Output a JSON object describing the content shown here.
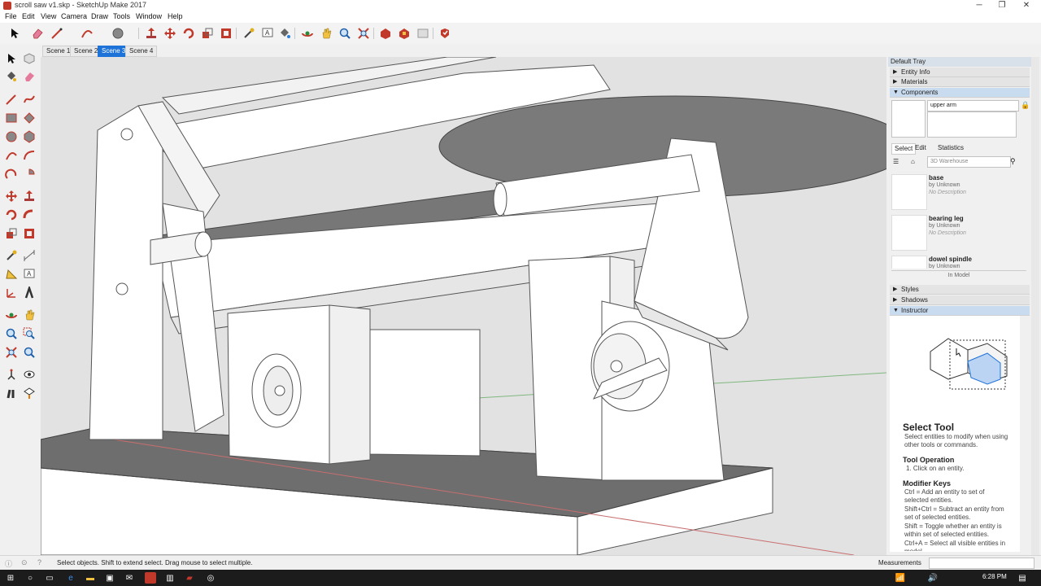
{
  "window": {
    "title": "scroll saw v1.skp - SketchUp Make 2017",
    "minimize": "─",
    "maximize": "❐",
    "close": "✕"
  },
  "menu": [
    "File",
    "Edit",
    "View",
    "Camera",
    "Draw",
    "Tools",
    "Window",
    "Help"
  ],
  "toolbar": {
    "icons": [
      "select-icon",
      "eraser-icon",
      "line-icon",
      "arc-icon",
      "shape-icon",
      "push-pull-icon",
      "move-icon",
      "rotate-icon",
      "scale-icon",
      "offset-icon",
      "tape-measure-icon",
      "text-icon",
      "paint-bucket-icon",
      "orbit-icon",
      "pan-icon",
      "zoom-icon",
      "zoom-extents-icon",
      "3d-warehouse-icon",
      "extension-warehouse-icon",
      "layout-icon",
      "extension-manager-icon",
      "ruby-icon"
    ]
  },
  "scenes": [
    "Scene 1",
    "Scene 2",
    "Scene 3",
    "Scene 4"
  ],
  "active_scene": "Scene 3",
  "tray": {
    "title": "Default Tray",
    "sections_top": [
      "Entity Info",
      "Materials",
      "Components"
    ],
    "component_name": "upper arm",
    "tabs": [
      "Select",
      "Edit",
      "Statistics"
    ],
    "search_placeholder": "3D Warehouse",
    "items": [
      {
        "name": "base",
        "by": "by Unknown",
        "desc": "No Description"
      },
      {
        "name": "bearing leg",
        "by": "by Unknown",
        "desc": "No Description"
      },
      {
        "name": "dowel spindle",
        "by": "by Unknown",
        "desc": ""
      }
    ],
    "in_model": "In Model",
    "sections_bottom": [
      "Styles",
      "Shadows",
      "Instructor"
    ],
    "instructor": {
      "title": "Select Tool",
      "intro": "Select entities to modify when using other tools or commands.",
      "op_title": "Tool Operation",
      "op_step": "1. Click on an entity.",
      "mod_title": "Modifier Keys",
      "mod_lines": [
        "Ctrl = Add an entity to set of selected entities.",
        "Shift+Ctrl = Subtract an entity from set of selected entities.",
        "Shift = Toggle whether an entity is within set of selected entities.",
        "Ctrl+A = Select all visible entities in model."
      ]
    }
  },
  "status": {
    "message": "Select objects. Shift to extend select. Drag mouse to select multiple.",
    "measurements_label": "Measurements"
  },
  "taskbar": {
    "time": "6:28 PM"
  },
  "colors": {
    "accent": "#1e73d8",
    "model_gray": "#7a7a7a",
    "model_white": "#ffffff",
    "axis_red": "#c86e6e",
    "axis_green": "#7fb87f"
  }
}
